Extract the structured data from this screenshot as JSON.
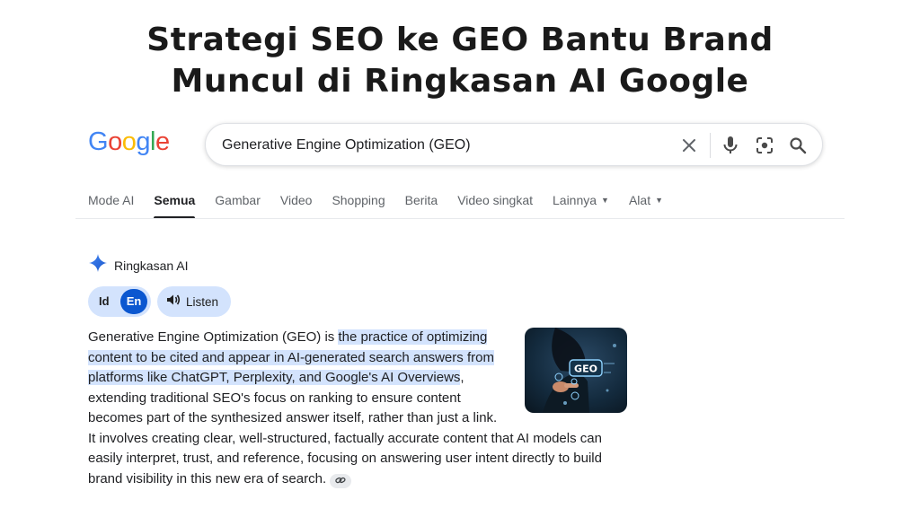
{
  "headline": {
    "line1": "Strategi SEO ke GEO Bantu Brand",
    "line2": "Muncul di Ringkasan AI Google"
  },
  "logo": {
    "text": "Google"
  },
  "search": {
    "value": "Generative Engine Optimization (GEO)",
    "icons": [
      "close-icon",
      "mic-icon",
      "lens-icon",
      "search-icon"
    ]
  },
  "tabs": [
    {
      "label": "Mode AI"
    },
    {
      "label": "Semua",
      "active": true
    },
    {
      "label": "Gambar"
    },
    {
      "label": "Video"
    },
    {
      "label": "Shopping"
    },
    {
      "label": "Berita"
    },
    {
      "label": "Video singkat"
    },
    {
      "label": "Lainnya",
      "dropdown": true
    },
    {
      "label": "Alat",
      "dropdown": true
    }
  ],
  "ai_overview": {
    "title": "Ringkasan AI",
    "lang_id": "Id",
    "lang_en": "En",
    "listen": "Listen",
    "image_label": "GEO",
    "text_before": "Generative Engine Optimization (GEO) is ",
    "text_highlight": "the practice of optimizing content to be cited and appear in AI-generated search answers from platforms like ChatGPT, Perplexity, and Google's AI Overviews",
    "text_after": ", extending traditional SEO's focus on ranking to ensure content becomes part of the synthesized answer itself, rather than just a link. It involves creating clear, well-structured, factually accurate content that AI models can easily interpret, trust, and reference, focusing on answering user intent directly to build brand visibility in this new era of search."
  },
  "colors": {
    "google_blue": "#4285f4",
    "google_red": "#ea4335",
    "google_yellow": "#fbbc05",
    "google_green": "#34a853",
    "highlight": "#d3e3fd",
    "active_lang": "#0b57d0"
  }
}
